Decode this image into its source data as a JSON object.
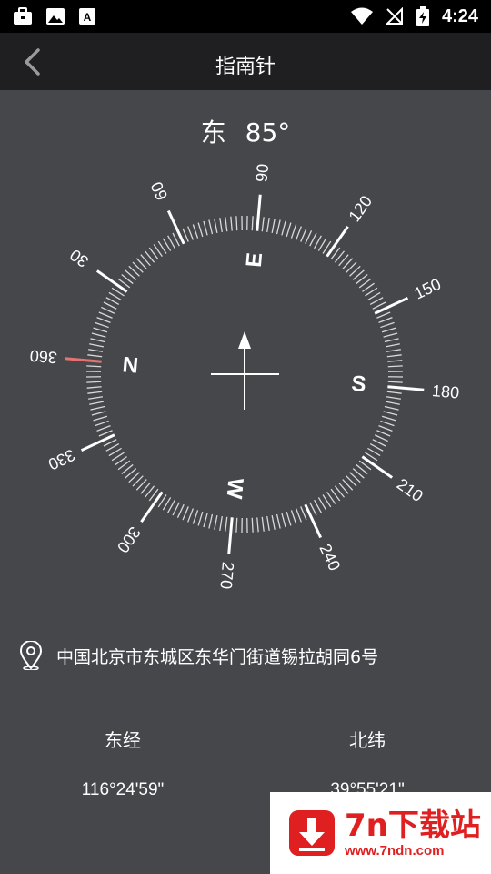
{
  "status_bar": {
    "time": "4:24"
  },
  "app_bar": {
    "title": "指南针"
  },
  "heading": {
    "direction": "东",
    "degrees": "85°"
  },
  "compass": {
    "degree_labels": [
      "90",
      "120",
      "150",
      "180",
      "210",
      "240",
      "270",
      "300",
      "330",
      "360",
      "30",
      "60"
    ],
    "cardinals": [
      "N",
      "E",
      "S",
      "W"
    ]
  },
  "address": {
    "text": "中国北京市东城区东华门街道锡拉胡同6号"
  },
  "longitude": {
    "label": "东经",
    "value": "116°24'59\""
  },
  "latitude": {
    "label": "北纬",
    "value": "39°55'21\""
  },
  "watermark": {
    "name": "7n下载站",
    "url": "www.7ndn.com"
  },
  "colors": {
    "accent_marker": "#e57373",
    "background": "#45474b",
    "appbar": "#1f1f21",
    "watermark_red": "#e02020"
  }
}
